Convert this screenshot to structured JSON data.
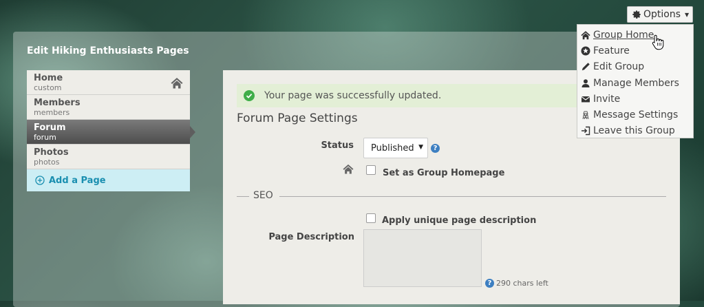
{
  "header": {
    "options_label": "Options"
  },
  "panel": {
    "title": "Edit Hiking Enthusiasts Pages"
  },
  "sidebar": {
    "items": [
      {
        "label": "Home",
        "sub": "custom",
        "active": false
      },
      {
        "label": "Members",
        "sub": "members",
        "active": false
      },
      {
        "label": "Forum",
        "sub": "forum",
        "active": true
      },
      {
        "label": "Photos",
        "sub": "photos",
        "active": false
      }
    ],
    "add_page_label": "Add a Page"
  },
  "main": {
    "alert": "Your page was successfully updated.",
    "section_title": "Forum Page Settings",
    "status_label": "Status",
    "status_value": "Published",
    "homepage_label": "Set as Group Homepage",
    "seo_label": "SEO",
    "unique_desc_label": "Apply unique page description",
    "page_desc_label": "Page Description",
    "chars_left": "290 chars left"
  },
  "menu": {
    "items": [
      {
        "label": "Group Home",
        "icon": "home-icon"
      },
      {
        "label": "Feature",
        "icon": "star-icon"
      },
      {
        "label": "Edit Group",
        "icon": "pencil-icon"
      },
      {
        "label": "Manage Members",
        "icon": "user-icon"
      },
      {
        "label": "Invite",
        "icon": "envelope-icon"
      },
      {
        "label": "Message Settings",
        "icon": "tower-icon"
      },
      {
        "label": "Leave this Group",
        "icon": "sign-out-icon"
      }
    ]
  },
  "colors": {
    "accent": "#1a8fb0",
    "success_bg": "#e3efd6",
    "success_icon": "#3fae49",
    "help": "#3d7fc1"
  }
}
